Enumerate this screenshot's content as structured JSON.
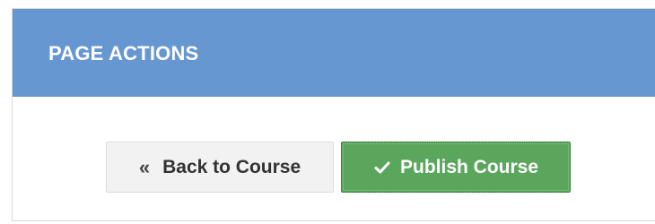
{
  "panel": {
    "title": "PAGE ACTIONS"
  },
  "actions": {
    "back_label": "Back to Course",
    "back_icon": "double-chevron-left-icon",
    "publish_label": "Publish Course",
    "publish_icon": "checkmark-icon"
  },
  "colors": {
    "header_bg": "#6697d1",
    "publish_bg": "#5ba65d",
    "back_bg": "#f2f2f2"
  }
}
